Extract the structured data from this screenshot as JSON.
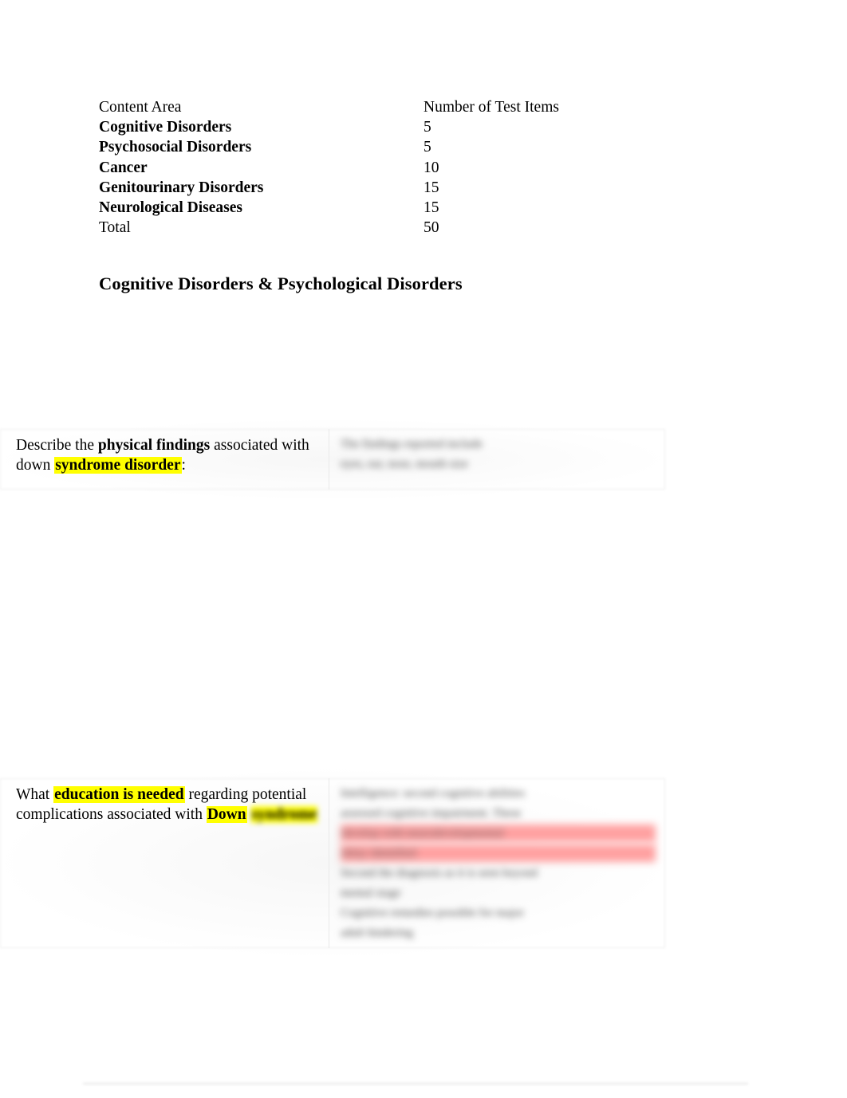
{
  "document": {
    "summary_table": {
      "header": {
        "content_area": "Content Area",
        "number_of_items": "Number of Test Items"
      },
      "rows": [
        {
          "area": "Cognitive Disorders",
          "count": "5",
          "bold": true
        },
        {
          "area": "Psychosocial Disorders",
          "count": "5",
          "bold": true
        },
        {
          "area": "Cancer",
          "count": "10",
          "bold": true
        },
        {
          "area": "Genitourinary Disorders",
          "count": "15",
          "bold": true
        },
        {
          "area": "Neurological Diseases",
          "count": "15",
          "bold": true
        },
        {
          "area": "Total",
          "count": "50",
          "bold": false
        }
      ]
    },
    "section_heading": "Cognitive Disorders & Psychological Disorders",
    "study_rows": [
      {
        "question": {
          "lead": "Describe the ",
          "bold_1": "physical findings",
          "middle": " associated with down ",
          "highlight_bold": "syndrome disorder",
          "trail": ":"
        },
        "answer": {
          "redacted": true,
          "line_1": "The findings reported include",
          "line_2": "eyes, ear, nose, mouth size"
        }
      },
      {
        "question": {
          "lead": "What ",
          "highlight_bold_1": "education is needed",
          "middle": " regarding potential complications associated with ",
          "bold_2": "Down",
          "highlight_redacted": "syndrome"
        },
        "answer": {
          "redacted": true,
          "line_1": "Intelligence: second cognitive abilities",
          "line_2": "assessed cognitive impairment. These",
          "line_3": "develop with neurodevelopmental",
          "line_4": "delay identified",
          "line_5": "Second the diagnosis as it is seen beyond",
          "line_6": "mental stage",
          "line_7": "Cognitive remedies possible for major",
          "line_8": "adult hindering"
        }
      }
    ],
    "colors": {
      "highlight_yellow": "#FFFF00",
      "highlight_pink": "#FFA0A0",
      "text": "#000000",
      "border": "#EDEDED"
    }
  }
}
